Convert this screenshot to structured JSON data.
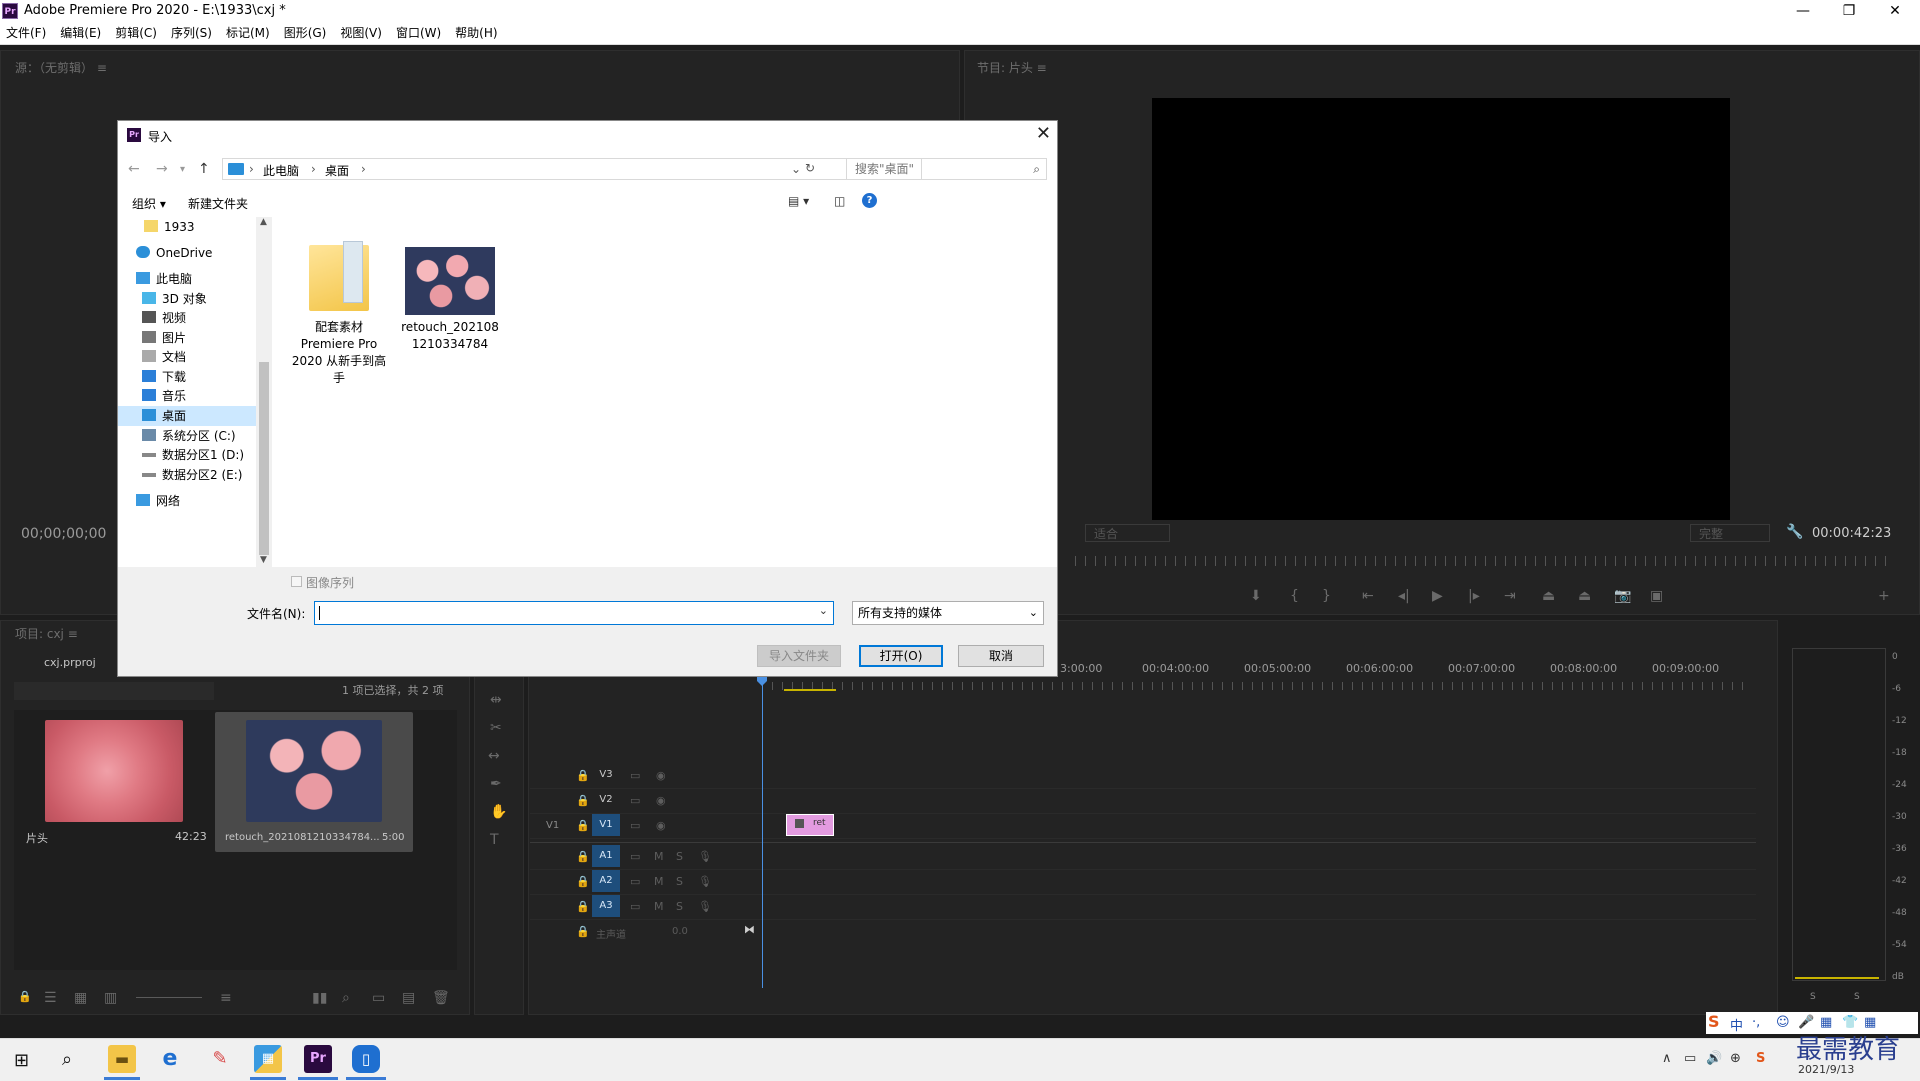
{
  "window": {
    "title": "Adobe Premiere Pro 2020 - E:\\1933\\cxj *",
    "app_icon": "Pr",
    "controls": [
      "—",
      "❐",
      "✕"
    ]
  },
  "menu": [
    "文件(F)",
    "编辑(E)",
    "剪辑(C)",
    "序列(S)",
    "标记(M)",
    "图形(G)",
    "视图(V)",
    "窗口(W)",
    "帮助(H)"
  ],
  "source_monitor": {
    "title": "源：（无剪辑） ≡",
    "timecode": "00;00;00;00"
  },
  "program_monitor": {
    "title": "节目: 片头 ≡",
    "fit": "适合",
    "quality": "完整",
    "timecode": "00:00:42:23"
  },
  "project_panel": {
    "tab": "项目: cxj ≡",
    "file": "cxj.prproj",
    "selection_info": "1 项已选择，共 2 项",
    "items": [
      {
        "name": "片头",
        "duration": "42:23"
      },
      {
        "name": "retouch_2021081210334784...",
        "duration": "5:00"
      }
    ]
  },
  "timeline": {
    "ruler": [
      "3:00:00",
      "00:04:00:00",
      "00:05:00:00",
      "00:06:00:00",
      "00:07:00:00",
      "00:08:00:00",
      "00:09:00:00"
    ],
    "video_tracks": [
      "V3",
      "V2",
      "V1"
    ],
    "audio_tracks": [
      "A1",
      "A2",
      "A3"
    ],
    "source_patch": "V1",
    "master": "主声道",
    "master_value": "0.0",
    "clip_label": "ret"
  },
  "audio_meter": {
    "scale": [
      "0",
      "-6",
      "-12",
      "-18",
      "-24",
      "-30",
      "-36",
      "-42",
      "-48",
      "-54",
      "dB"
    ],
    "solo": [
      "S",
      "S"
    ]
  },
  "import_dialog": {
    "title": "导入",
    "breadcrumb": [
      "此电脑",
      "桌面"
    ],
    "search_placeholder": "搜索\"桌面\"",
    "organize": "组织 ▾",
    "new_folder": "新建文件夹",
    "nav_items": [
      {
        "label": "1933",
        "icon": "folder-icon"
      },
      {
        "label": "OneDrive",
        "icon": "cloud-icon"
      },
      {
        "label": "此电脑",
        "icon": "computer-icon"
      },
      {
        "label": "3D 对象",
        "icon": "cube-icon"
      },
      {
        "label": "视频",
        "icon": "video-icon"
      },
      {
        "label": "图片",
        "icon": "picture-icon"
      },
      {
        "label": "文档",
        "icon": "document-icon"
      },
      {
        "label": "下载",
        "icon": "download-icon"
      },
      {
        "label": "音乐",
        "icon": "music-icon"
      },
      {
        "label": "桌面",
        "icon": "desktop-icon"
      },
      {
        "label": "系统分区 (C:)",
        "icon": "drive-icon"
      },
      {
        "label": "数据分区1 (D:)",
        "icon": "drive-icon"
      },
      {
        "label": "数据分区2 (E:)",
        "icon": "drive-icon"
      },
      {
        "label": "网络",
        "icon": "network-icon"
      }
    ],
    "files": [
      {
        "label_lines": [
          "配套素材",
          "Premiere Pro",
          "2020 从新手到高",
          "手"
        ]
      },
      {
        "label_lines": [
          "retouch_202108",
          "1210334784"
        ]
      }
    ],
    "image_sequence": "图像序列",
    "filename_label": "文件名(N):",
    "filename_value": "",
    "filetype": "所有支持的媒体",
    "import_folder_btn": "导入文件夹",
    "open_btn": "打开(O)",
    "cancel_btn": "取消"
  },
  "taskbar": {
    "date": "2021/9/13",
    "watermark": "最需教育",
    "tray": [
      "∧",
      "▭",
      "🔊",
      "⊕",
      "S"
    ],
    "ime": [
      "S",
      "中",
      "·,",
      "☺",
      "🎤",
      "▦",
      "👕",
      "▦"
    ]
  }
}
